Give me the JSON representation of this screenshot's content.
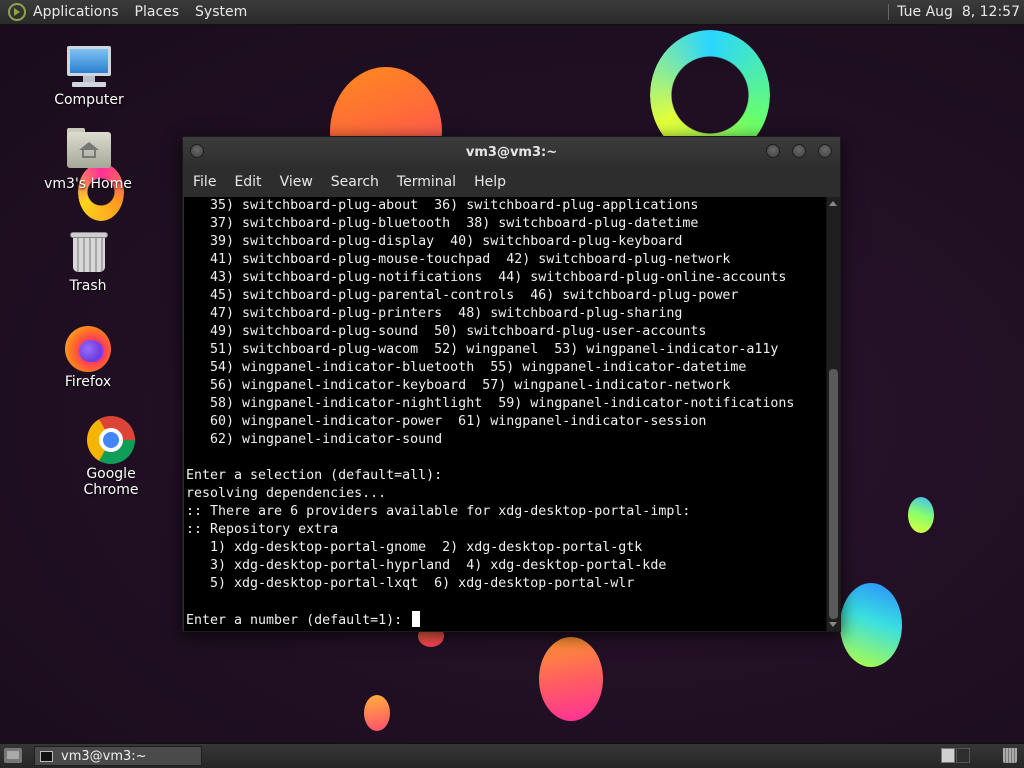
{
  "top_panel": {
    "menus": [
      "Applications",
      "Places",
      "System"
    ],
    "clock": "Tue Aug  8, 12:57"
  },
  "desktop_icons": {
    "computer": "Computer",
    "home": "vm3's Home",
    "trash": "Trash",
    "firefox": "Firefox",
    "chrome": "Google Chrome"
  },
  "terminal": {
    "title": "vm3@vm3:~",
    "menus": [
      "File",
      "Edit",
      "View",
      "Search",
      "Terminal",
      "Help"
    ],
    "lines": [
      "   35) switchboard-plug-about  36) switchboard-plug-applications",
      "   37) switchboard-plug-bluetooth  38) switchboard-plug-datetime",
      "   39) switchboard-plug-display  40) switchboard-plug-keyboard",
      "   41) switchboard-plug-mouse-touchpad  42) switchboard-plug-network",
      "   43) switchboard-plug-notifications  44) switchboard-plug-online-accounts",
      "   45) switchboard-plug-parental-controls  46) switchboard-plug-power",
      "   47) switchboard-plug-printers  48) switchboard-plug-sharing",
      "   49) switchboard-plug-sound  50) switchboard-plug-user-accounts",
      "   51) switchboard-plug-wacom  52) wingpanel  53) wingpanel-indicator-a11y",
      "   54) wingpanel-indicator-bluetooth  55) wingpanel-indicator-datetime",
      "   56) wingpanel-indicator-keyboard  57) wingpanel-indicator-network",
      "   58) wingpanel-indicator-nightlight  59) wingpanel-indicator-notifications",
      "   60) wingpanel-indicator-power  61) wingpanel-indicator-session",
      "   62) wingpanel-indicator-sound",
      "",
      "Enter a selection (default=all):",
      "resolving dependencies...",
      ":: There are 6 providers available for xdg-desktop-portal-impl:",
      ":: Repository extra",
      "   1) xdg-desktop-portal-gnome  2) xdg-desktop-portal-gtk",
      "   3) xdg-desktop-portal-hyprland  4) xdg-desktop-portal-kde",
      "   5) xdg-desktop-portal-lxqt  6) xdg-desktop-portal-wlr",
      ""
    ],
    "prompt": "Enter a number (default=1): "
  },
  "bottom_panel": {
    "task_title": "vm3@vm3:~"
  },
  "icons": {
    "distro": "distro-logo-icon",
    "computer": "monitor-icon",
    "home": "home-folder-icon",
    "trash": "trash-icon",
    "firefox": "firefox-icon",
    "chrome": "chrome-icon",
    "terminal": "terminal-icon"
  },
  "colors": {
    "panel_bg": "#2e2e2e",
    "terminal_bg": "#000000",
    "terminal_fg": "#f0f0f0",
    "desktop_bg": "#221025"
  }
}
